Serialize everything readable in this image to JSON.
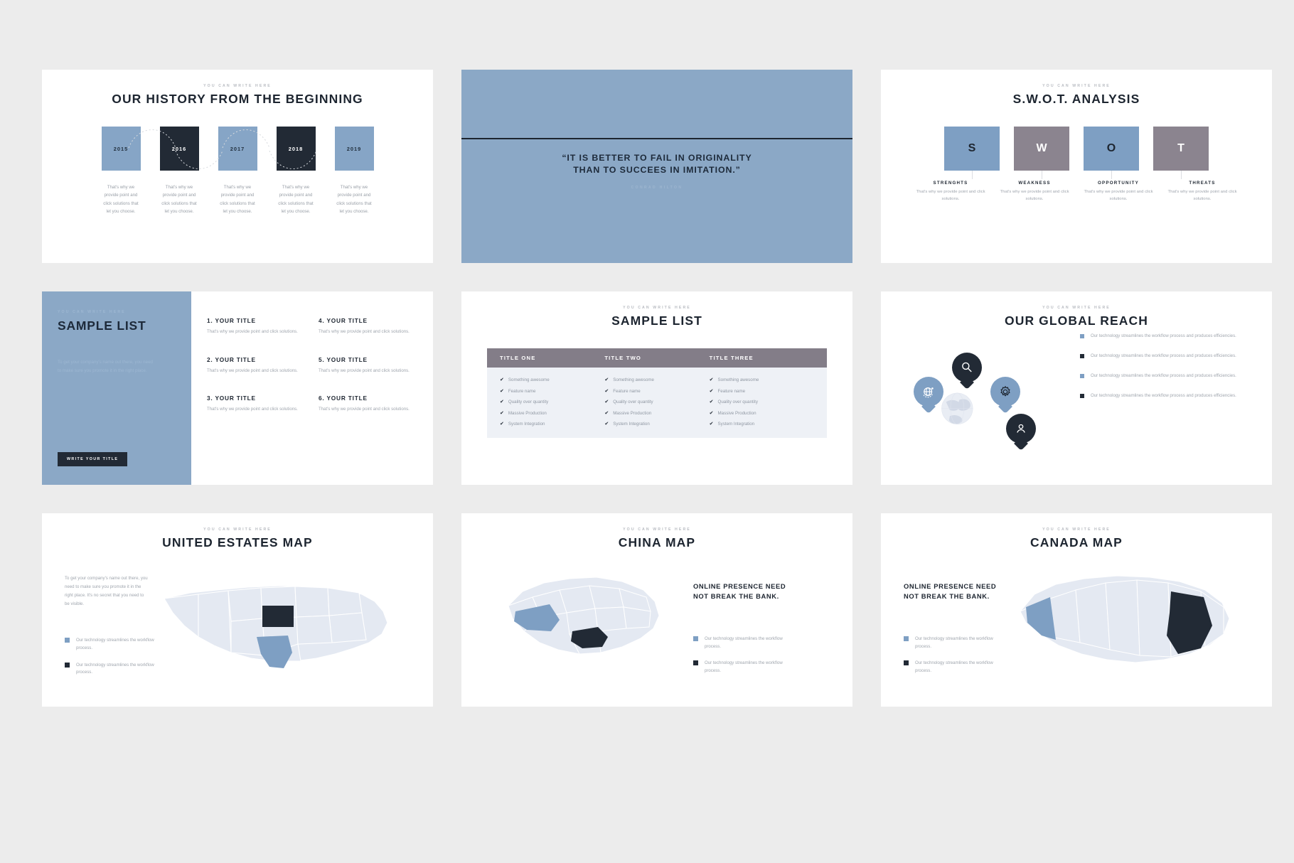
{
  "deck": {
    "slides": [
      {
        "id": "history",
        "eyebrow": "YOU CAN WRITE HERE",
        "title": "OUR HISTORY FROM THE BEGINNING",
        "milestones": [
          {
            "year": "2015",
            "style": "blue",
            "desc": "That's why we provide point and click solutions that let you choose."
          },
          {
            "year": "2016",
            "style": "dark",
            "desc": "That's why we provide point and click solutions that let you choose."
          },
          {
            "year": "2017",
            "style": "blue",
            "desc": "That's why we provide point and click solutions that let you choose."
          },
          {
            "year": "2018",
            "style": "dark",
            "desc": "That's why we provide point and click solutions that let you choose."
          },
          {
            "year": "2019",
            "style": "blue",
            "desc": "That's why we provide point and click solutions that let you choose."
          }
        ]
      },
      {
        "id": "quote",
        "line1": "“IT IS BETTER TO FAIL IN ORIGINALITY",
        "line2": "THAN TO SUCCEES IN IMITATION.”",
        "author": "CONRAD HILTON"
      },
      {
        "id": "swot",
        "eyebrow": "YOU CAN WRITE HERE",
        "title": "S.W.O.T. ANALYSIS",
        "items": [
          {
            "letter": "S",
            "style": "blue",
            "name": "STRENGHTS",
            "desc": "That's why we provide point and click solutions."
          },
          {
            "letter": "W",
            "style": "mauve",
            "name": "WEAKNESS",
            "desc": "That's why we provide point and click solutions."
          },
          {
            "letter": "O",
            "style": "blue",
            "name": "OPPORTUNITY",
            "desc": "That's why we provide point and click solutions."
          },
          {
            "letter": "T",
            "style": "mauve",
            "name": "THREATS",
            "desc": "That's why we provide point and click solutions."
          }
        ]
      },
      {
        "id": "sample-list-panel",
        "eyebrow": "YOU CAN WRITE HERE",
        "title": "SAMPLE LIST",
        "body": "To get your company's name out there, you need to make sure you promote it in the right place.",
        "button": "WRITE YOUR TITLE",
        "items": [
          {
            "title": "1. YOUR TITLE",
            "desc": "That's why we provide point and click solutions."
          },
          {
            "title": "4. YOUR TITLE",
            "desc": "That's why we provide point and click solutions."
          },
          {
            "title": "2. YOUR TITLE",
            "desc": "That's why we provide point and click solutions."
          },
          {
            "title": "5. YOUR TITLE",
            "desc": "That's why we provide point and click solutions."
          },
          {
            "title": "3. YOUR TITLE",
            "desc": "That's why we provide point and click solutions."
          },
          {
            "title": "6. YOUR TITLE",
            "desc": "That's why we provide point and click solutions."
          }
        ]
      },
      {
        "id": "sample-list-table",
        "eyebrow": "YOU CAN WRITE HERE",
        "title": "SAMPLE LIST",
        "columns": [
          "TITLE ONE",
          "TITLE TWO",
          "TITLE THREE"
        ],
        "rows": [
          "Something awesome",
          "Feature name",
          "Quality over quantity",
          "Massive Production",
          "System Integration"
        ],
        "check_glyph": "✔"
      },
      {
        "id": "global-reach",
        "eyebrow": "YOU CAN WRITE HERE",
        "title": "OUR GLOBAL REACH",
        "pins": [
          {
            "icon": "globe-icon",
            "style": "blue"
          },
          {
            "icon": "magnifier-icon",
            "style": "dark"
          },
          {
            "icon": "gear-icon",
            "style": "blue"
          },
          {
            "icon": "person-icon",
            "style": "dark"
          }
        ],
        "bullets": [
          {
            "style": "blue",
            "text": "Our technology streamlines the workflow process and produces efficiencies."
          },
          {
            "style": "dark",
            "text": "Our technology streamlines the workflow process and produces efficiencies."
          },
          {
            "style": "blue",
            "text": "Our technology streamlines the workflow process and produces efficiencies."
          },
          {
            "style": "dark",
            "text": "Our technology streamlines the workflow process and produces efficiencies."
          }
        ]
      },
      {
        "id": "us-map",
        "eyebrow": "YOU CAN WRITE HERE",
        "title": "UNITED ESTATES MAP",
        "paragraph": "To get your company's name out there, you need to make sure you promote it in the right place. It's no secret that you need to be visible.",
        "legend": [
          {
            "style": "blue",
            "text": "Our technology streamlines the workflow process."
          },
          {
            "style": "dark",
            "text": "Our technology streamlines the workflow process."
          }
        ]
      },
      {
        "id": "china-map",
        "eyebrow": "YOU CAN WRITE HERE",
        "title": "CHINA MAP",
        "headline": "ONLINE PRESENCE NEED NOT BREAK THE BANK.",
        "legend": [
          {
            "style": "blue",
            "text": "Our technology streamlines the workflow process."
          },
          {
            "style": "dark",
            "text": "Our technology streamlines the workflow process."
          }
        ]
      },
      {
        "id": "canada-map",
        "eyebrow": "YOU CAN WRITE HERE",
        "title": "CANADA MAP",
        "headline": "ONLINE PRESENCE NEED NOT BREAK THE BANK.",
        "legend": [
          {
            "style": "blue",
            "text": "Our technology streamlines the workflow process."
          },
          {
            "style": "dark",
            "text": "Our technology streamlines the workflow process."
          }
        ]
      }
    ]
  },
  "colors": {
    "accent_blue": "#8ba8c6",
    "accent_blue_deep": "#7e9fc3",
    "dark": "#222a35",
    "mauve": "#837d88",
    "muted_text": "#a0a6ae",
    "table_body": "#eef1f6",
    "page_bg": "#ececec",
    "map_land": "#e4e9f2"
  }
}
